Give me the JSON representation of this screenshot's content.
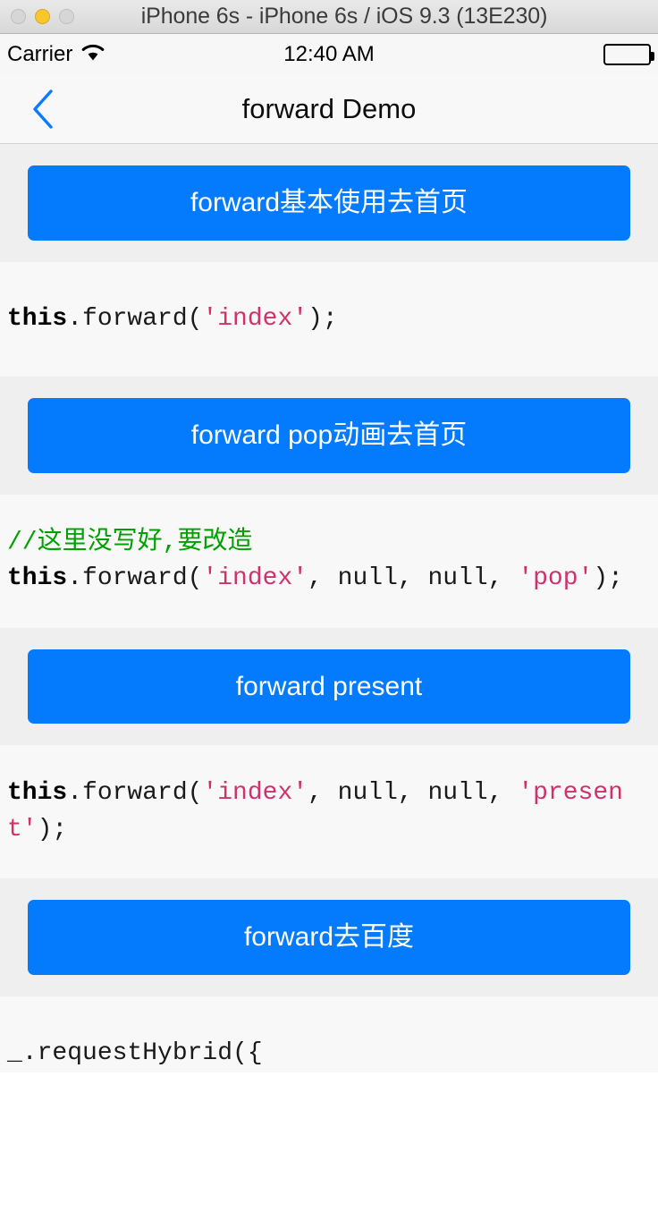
{
  "window": {
    "title": "iPhone 6s - iPhone 6s / iOS 9.3 (13E230)",
    "controls": {
      "close_label": "close",
      "minimize_label": "minimize",
      "zoom_label": "zoom"
    }
  },
  "status_bar": {
    "carrier": "Carrier",
    "wifi_icon": "wifi-icon",
    "time": "12:40 AM",
    "battery_icon": "battery-full-icon"
  },
  "nav_bar": {
    "back_icon": "chevron-left-icon",
    "title": "forward Demo"
  },
  "colors": {
    "accent_blue": "#047bfd",
    "string_pink": "#d1306b",
    "comment_green": "#00a000",
    "section_button_bg": "#efefef",
    "section_code_bg": "#f8f8f8",
    "nav_bg": "#f8f8f8"
  },
  "sections": [
    {
      "button_label": "forward基本使用去首页",
      "code": {
        "comment": "",
        "kw": "this",
        "mid": ".forward(",
        "str1": "'index'",
        "tail": ");"
      }
    },
    {
      "button_label": "forward pop动画去首页",
      "code": {
        "comment": "//这里没写好,要改造",
        "kw": "this",
        "mid": ".forward(",
        "str1": "'index'",
        "args": ", null, null, ",
        "str2": "'pop'",
        "tail": ");"
      }
    },
    {
      "button_label": "forward present",
      "code": {
        "comment": "",
        "kw": "this",
        "mid": ".forward(",
        "str1": "'index'",
        "args": ", null, null, ",
        "str2": "'present'",
        "tail": ");"
      }
    },
    {
      "button_label": "forward去百度",
      "code": {
        "comment": "",
        "kw": "",
        "mid": "_.requestHybrid({",
        "str1": "",
        "tail": ""
      }
    }
  ]
}
